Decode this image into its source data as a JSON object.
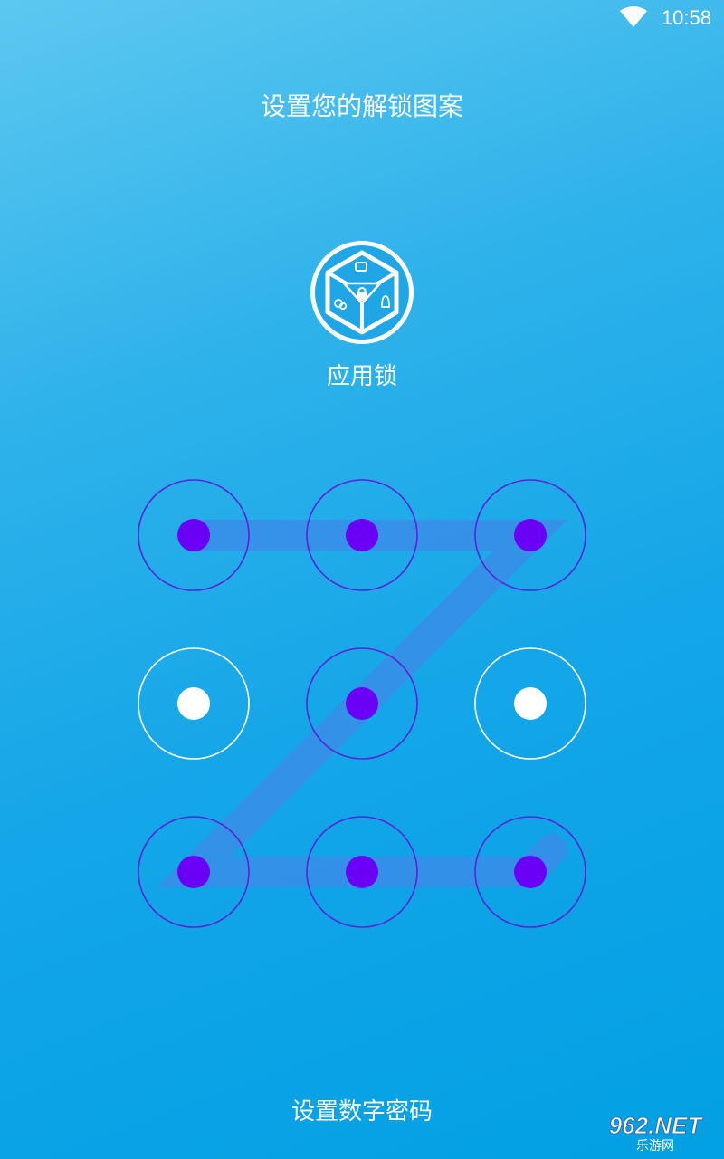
{
  "status_bar": {
    "time": "10:58",
    "wifi_icon": "wifi-icon"
  },
  "header": {
    "prompt": "设置您的解锁图案"
  },
  "app": {
    "icon": "app-lock-cube-icon",
    "name": "应用锁"
  },
  "pattern": {
    "selected_sequence": [
      1,
      2,
      3,
      5,
      7,
      8,
      9
    ],
    "colors": {
      "selected_dot": "#6a00f4",
      "selected_ring": "#5a23d6",
      "unselected_dot": "#ffffff",
      "unselected_ring": "#ffffff",
      "line": "#3a8de8"
    }
  },
  "footer": {
    "switch_to_pin": "设置数字密码"
  },
  "watermark": {
    "brand": "962.NET",
    "sub": "乐游网"
  }
}
